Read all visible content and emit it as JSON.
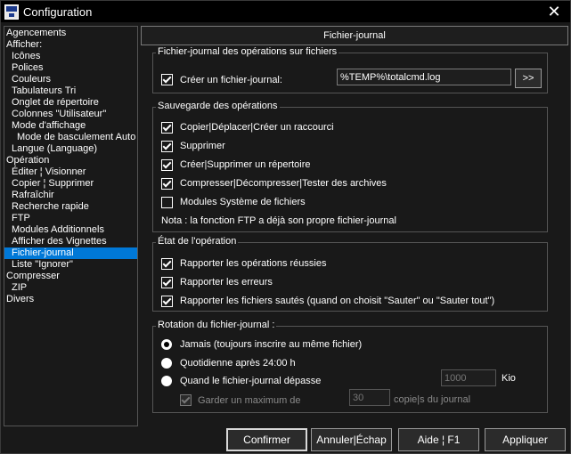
{
  "window": {
    "title": "Configuration",
    "close_glyph": "✕"
  },
  "tree": [
    "Agencements",
    "Afficher:",
    "Icônes",
    "Polices",
    "Couleurs",
    "Tabulateurs Tri",
    "Onglet de répertoire",
    "Colonnes \"Utilisateur\"",
    "Mode d'affichage",
    "Mode de basculement Auto",
    "Langue (Language)",
    "Opération",
    "Éditer ¦ Visionner",
    "Copier ¦ Supprimer",
    "Rafraîchir",
    "Recherche rapide",
    "FTP",
    "Modules Additionnels",
    "Afficher des Vignettes",
    "Fichier-journal",
    "Liste \"Ignorer\"",
    "Compresser",
    "ZIP",
    "Divers"
  ],
  "page_header": "Fichier-journal",
  "group_logfile": {
    "legend": "Fichier-journal des opérations sur fichiers",
    "create_label": "Créer un fichier-journal:",
    "path_value": "%TEMP%\\totalcmd.log",
    "browse_label": ">>"
  },
  "group_save": {
    "legend": "Sauvegarde des opérations",
    "items": [
      "Copier|Déplacer|Créer un raccourci",
      "Supprimer",
      "Créer|Supprimer un répertoire",
      "Compresser|Décompresser|Tester des archives",
      "Modules Système de fichiers"
    ],
    "note": "Nota : la fonction FTP a déjà son propre fichier-journal"
  },
  "group_status": {
    "legend": "État de l'opération",
    "items": [
      "Rapporter les opérations réussies",
      "Rapporter les erreurs",
      "Rapporter les fichiers sautés (quand on choisit \"Sauter\" ou \"Sauter tout\")"
    ]
  },
  "group_rotation": {
    "legend": "Rotation du fichier-journal :",
    "radio_never": "Jamais (toujours inscrire au même fichier)",
    "radio_daily": "Quotidienne après 24:00 h",
    "radio_size": "Quand le fichier-journal dépasse",
    "size_value": "1000",
    "size_unit": "Kio",
    "keep_label": "Garder un maximum de",
    "copies_value": "30",
    "copies_label": "copie|s du journal"
  },
  "buttons": {
    "ok": "Confirmer",
    "cancel": "Annuler|Échap",
    "help": "Aide ¦ F1",
    "apply": "Appliquer"
  }
}
